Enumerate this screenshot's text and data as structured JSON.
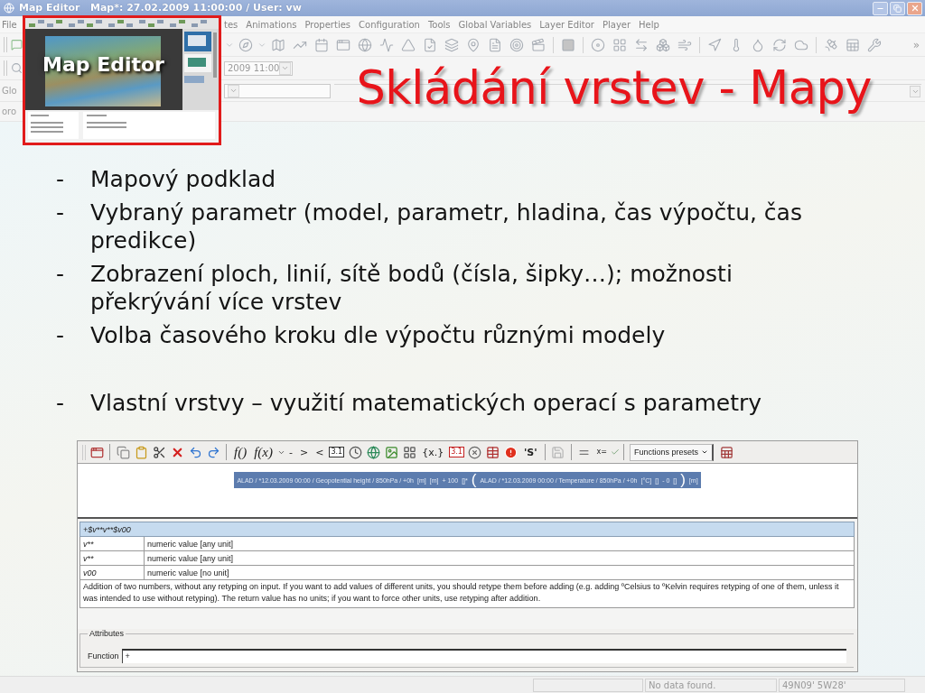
{
  "window": {
    "title": "Map Editor   Map*: 27.02.2009 11:00:00 / User: vw"
  },
  "menu": [
    "File",
    "tes",
    "Animations",
    "Properties",
    "Configuration",
    "Tools",
    "Global Variables",
    "Layer Editor",
    "Player",
    "Help"
  ],
  "toolbar": {
    "overflow": "»"
  },
  "time_selector": {
    "value": "2009 11:00"
  },
  "filter_row": {
    "label": "Glo"
  },
  "tab_row": {
    "label": "oro"
  },
  "logo_inset": {
    "caption": "Map Editor"
  },
  "slide": {
    "title": "Skládání vrstev - Mapy",
    "bullet_groups": [
      [
        {
          "marker": "-",
          "text": "Mapový podklad"
        },
        {
          "marker": "-",
          "text": "Vybraný parametr (model, parametr, hladina, čas výpočtu, čas predikce)"
        },
        {
          "marker": "-",
          "text": "Zobrazení ploch, linií, sítě bodů (čísla, šipky…); možnosti překrývání více vrstev"
        },
        {
          "marker": "-",
          "text": "Volba časového kroku dle výpočtu různými modely"
        }
      ],
      [
        {
          "marker": "-",
          "text": "Vlastní vrstvy – využití matematických operací s parametry"
        }
      ]
    ]
  },
  "editor": {
    "toolbar_glyphs": [
      "f()",
      "f(x)",
      "-",
      ">",
      "<",
      "3.1",
      "{x.}",
      "3.1",
      "'S'",
      "x="
    ],
    "presets": "Functions presets",
    "expression": [
      {
        "kind": "text",
        "text": "ALAD / *12.03.2009 00:00 / Geopotential height / 850hPa / +0h"
      },
      {
        "kind": "text",
        "text": "[m]"
      },
      {
        "kind": "text",
        "text": "[m]"
      },
      {
        "kind": "text",
        "text": "+ 100"
      },
      {
        "kind": "text",
        "text": "[]*"
      },
      {
        "kind": "paren",
        "text": "("
      },
      {
        "kind": "text",
        "text": "ALAD / *12.03.2009 00:00 / Temperature / 850hPa / +0h"
      },
      {
        "kind": "text",
        "text": "[°C]"
      },
      {
        "kind": "text",
        "text": "[]"
      },
      {
        "kind": "text",
        "text": "- 0"
      },
      {
        "kind": "text",
        "text": "[]"
      },
      {
        "kind": "paren",
        "text": ")"
      },
      {
        "kind": "text",
        "text": "[m]"
      }
    ],
    "table": {
      "header": "+$v**v**$v00",
      "rows": [
        {
          "name": "v**",
          "description": "numeric value [any unit]"
        },
        {
          "name": "v**",
          "description": "numeric value [any unit]"
        },
        {
          "name": "v00",
          "description": "numeric value [no unit]"
        }
      ],
      "note": "Addition of two numbers, without any retyping on input. If you want to add values of different units, you should retype them before adding (e.g. adding ºCelsius to ºKelvin requires retyping of one of them, unless it was intended to use without retyping). The return value has no units; if you want to force other units, use retyping after addition."
    },
    "attributes": {
      "legend": "Attributes",
      "label": "Function",
      "value": "+"
    }
  },
  "status_bar": {
    "fields": [
      "No data found.",
      "49N09' 5W28'"
    ]
  }
}
